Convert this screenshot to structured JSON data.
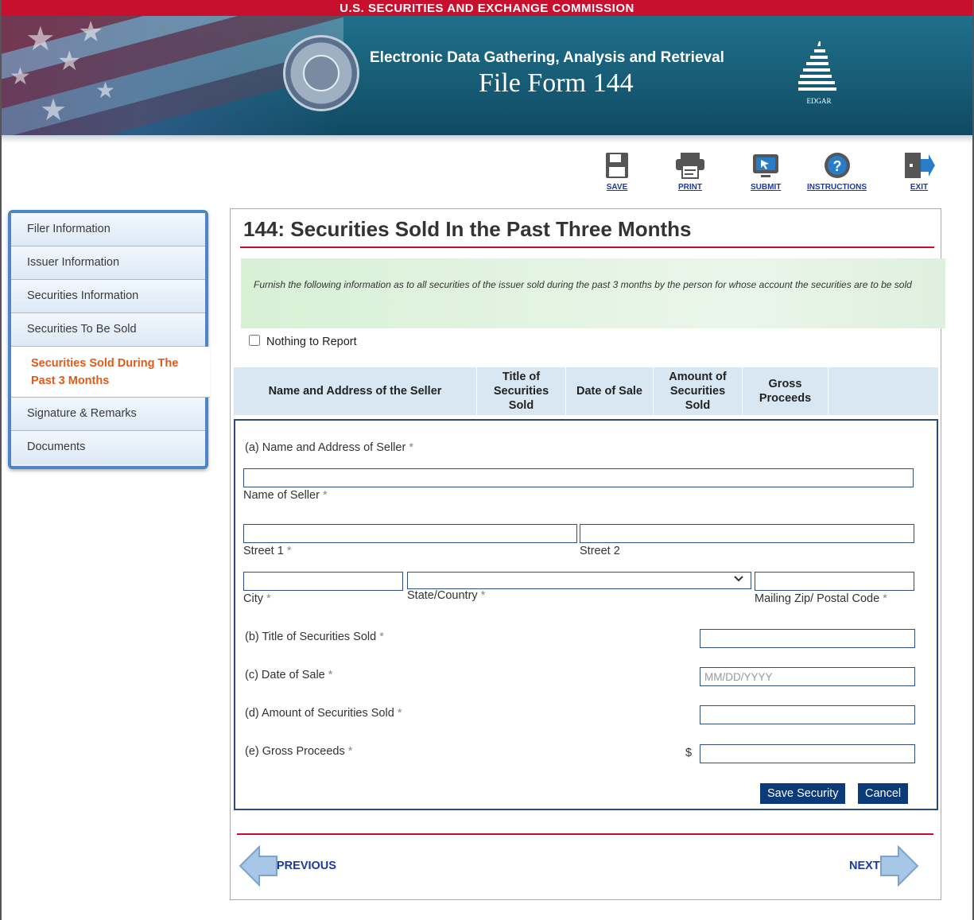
{
  "header": {
    "agency": "U.S. SECURITIES AND EXCHANGE COMMISSION",
    "subtitle": "Electronic Data Gathering, Analysis and Retrieval",
    "title": "File Form 144",
    "logo_text": "EDGAR"
  },
  "toolbar": [
    {
      "label": "SAVE",
      "icon": "floppy-disk-icon"
    },
    {
      "label": "PRINT",
      "icon": "printer-icon"
    },
    {
      "label": "SUBMIT",
      "icon": "monitor-submit-icon"
    },
    {
      "label": "INSTRUCTIONS",
      "icon": "question-circle-icon"
    },
    {
      "label": "EXIT",
      "icon": "exit-door-icon"
    }
  ],
  "sidebar": {
    "items": [
      {
        "label": "Filer Information"
      },
      {
        "label": "Issuer Information"
      },
      {
        "label": "Securities Information"
      },
      {
        "label": "Securities To Be Sold"
      },
      {
        "label": "Securities Sold During The Past 3 Months",
        "active": true
      },
      {
        "label": "Signature & Remarks"
      },
      {
        "label": "Documents"
      }
    ]
  },
  "main": {
    "title": "144: Securities Sold In the Past Three Months",
    "info": "Furnish the following information as to all securities of the issuer sold during the past 3 months by the person for whose account the securities are to be sold",
    "nothing_to_report": "Nothing to Report",
    "table_headers": [
      "Name and Address of the Seller",
      "Title of Securities Sold",
      "Date of Sale",
      "Amount of Securities Sold",
      "Gross Proceeds",
      ""
    ],
    "form": {
      "a_label": "(a)  Name and Address of Seller",
      "name_of_seller": "Name of Seller",
      "street1": "Street 1",
      "street2": "Street 2",
      "city": "City",
      "state_country": "State/Country",
      "zip": "Mailing Zip/ Postal Code",
      "b_label": "(b)  Title of Securities Sold",
      "c_label": "(c)  Date of Sale",
      "date_placeholder": "MM/DD/YYYY",
      "d_label": "(d)  Amount of Securities Sold",
      "e_label": "(e)  Gross Proceeds",
      "currency": "$",
      "required_mark": "*",
      "save_button": "Save Security",
      "cancel_button": "Cancel"
    },
    "nav": {
      "previous": "PREVIOUS",
      "next": "NEXT"
    }
  }
}
